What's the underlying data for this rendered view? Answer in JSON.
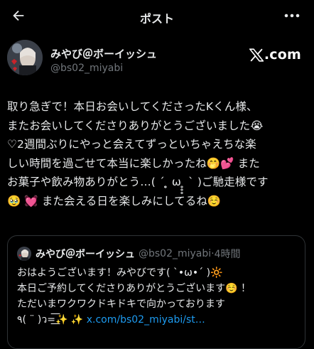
{
  "header": {
    "title": "ポスト",
    "back_icon": "arrow-left-icon",
    "more_icon": "more-horizontal-icon"
  },
  "author": {
    "display_name": "みやび＠ボーイッシュ",
    "handle": "@bs02_miyabi",
    "source_label": ".com",
    "source_icon": "x-logo-icon"
  },
  "post": {
    "text": "取り急ぎで！本日お会いしてくださったKくん様、\nまたお会いしてくださりありがとうございました😭\n♡2週間ぶりにやっと会えてずっといちゃえちな楽\nしい時間を過ごせて本当に楽しかったね🤭💕 また\nお菓子や飲み物ありがとう…( ´ ̥̥̥ ω ̥̥̥ ` )ご馳走様です\n🥹 💓 また会える日を楽しみにしてるね☺️"
  },
  "quote": {
    "display_name": "みやび＠ボーイッシュ",
    "handle": "@bs02_miyabi",
    "separator": "·",
    "time": "4時間",
    "text": "おはようございます！みやびです( ˋ•ω•ˊ )🔆\n本日ご予約してくださりありがとうございます☺️ ！\nただいまワクワクドキドキで向かっております\n٩( ¨ )ว=͟͟͞͞✨ ✨ ",
    "link": "x.com/bs02_miyabi/st…"
  },
  "colors": {
    "background": "#000000",
    "text_primary": "#e7e9ea",
    "text_secondary": "#71767b",
    "link": "#1d9bf0",
    "border": "#2f3336"
  }
}
